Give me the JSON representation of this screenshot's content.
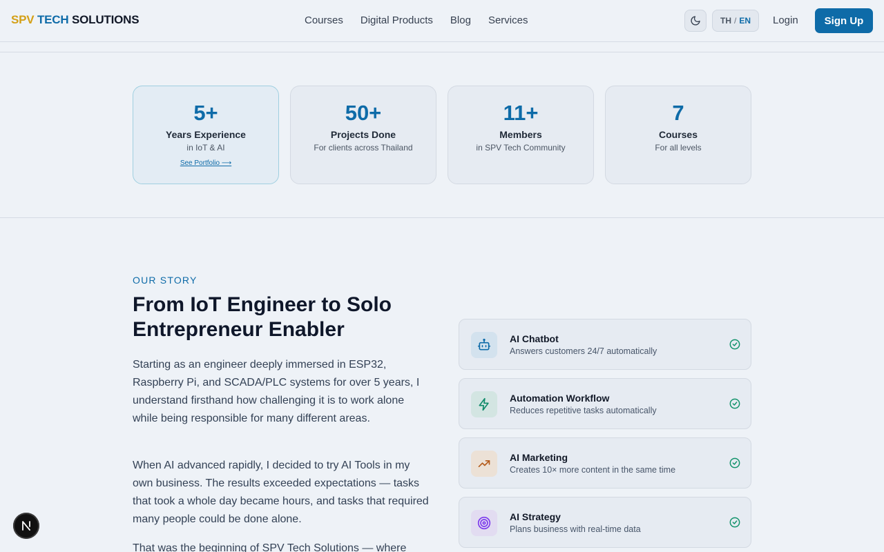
{
  "header": {
    "logo": {
      "part1": "SPV",
      "part2": "TECH",
      "part3": "SOLUTIONS"
    },
    "nav": [
      "Courses",
      "Digital Products",
      "Blog",
      "Services"
    ],
    "lang": {
      "th": "TH",
      "sep": "/",
      "en": "EN"
    },
    "login": "Login",
    "signup": "Sign Up"
  },
  "stats": [
    {
      "num": "5+",
      "label": "Years Experience",
      "sub": "in IoT & AI",
      "link": "See Portfolio ⟶"
    },
    {
      "num": "50+",
      "label": "Projects Done",
      "sub": "For clients across Thailand"
    },
    {
      "num": "11+",
      "label": "Members",
      "sub": "in SPV Tech Community"
    },
    {
      "num": "7",
      "label": "Courses",
      "sub": "For all levels"
    }
  ],
  "story": {
    "eyebrow": "OUR STORY",
    "title": "From IoT Engineer to Solo Entrepreneur Enabler",
    "paragraphs": [
      "Starting as an engineer deeply immersed in ESP32, Raspberry Pi, and SCADA/PLC systems for over 5 years, I understand firsthand how challenging it is to work alone while being responsible for many different areas.",
      "When AI advanced rapidly, I decided to try AI Tools in my own business. The results exceeded expectations — tasks that took a whole day became hours, and tasks that required many people could be done alone.",
      "That was the beginning of SPV Tech Solutions — where"
    ]
  },
  "features": [
    {
      "title": "AI Chatbot",
      "desc": "Answers customers 24/7 automatically",
      "icon": "robot-icon",
      "color": "#0e6ba8",
      "bg": "#d3e2ee"
    },
    {
      "title": "Automation Workflow",
      "desc": "Reduces repetitive tasks automatically",
      "icon": "lightning-icon",
      "color": "#0f8a6a",
      "bg": "#d3e5e2"
    },
    {
      "title": "AI Marketing",
      "desc": "Creates 10× more content in the same time",
      "icon": "trending-up-icon",
      "color": "#b45a1a",
      "bg": "#ece1d6"
    },
    {
      "title": "AI Strategy",
      "desc": "Plans business with real-time data",
      "icon": "target-icon",
      "color": "#7c3aed",
      "bg": "#e2dcf1"
    }
  ],
  "colors": {
    "accent": "#0e6ba8",
    "gold": "#d4a017",
    "check": "#10926a"
  },
  "badge": {
    "letter": "N"
  }
}
